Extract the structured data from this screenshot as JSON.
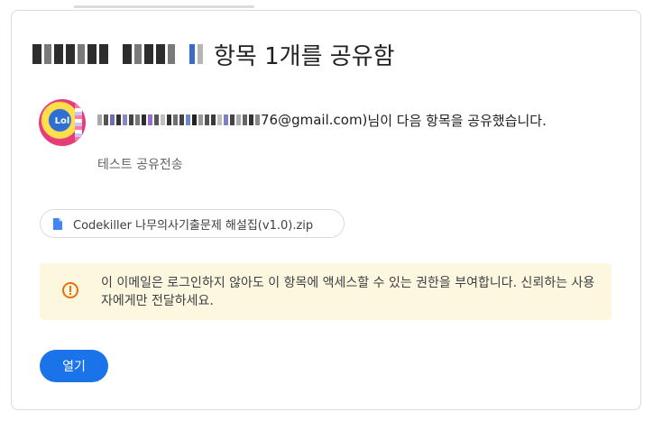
{
  "header": {
    "title_suffix": "항목 1개를 공유함"
  },
  "sender": {
    "email_suffix": "76@gmail.com)",
    "shared_text": "님이 다음 항목을 공유했습니다.",
    "message": "테스트 공유전송"
  },
  "file": {
    "name": "Codekiller 나무의사기출문제 해설집(v1.0).zip",
    "icon": "document-icon"
  },
  "notice": {
    "text": "이 이메일은 로그인하지 않아도 이 항목에 액세스할 수 있는 권한을 부여합니다. 신뢰하는 사용자에게만 전달하세요.",
    "icon": "warning-icon"
  },
  "actions": {
    "open_label": "열기"
  },
  "colors": {
    "accent": "#1a73e8",
    "notice_background": "#fef7e0",
    "notice_icon": "#e8710a",
    "file_icon": "#4285f4"
  }
}
